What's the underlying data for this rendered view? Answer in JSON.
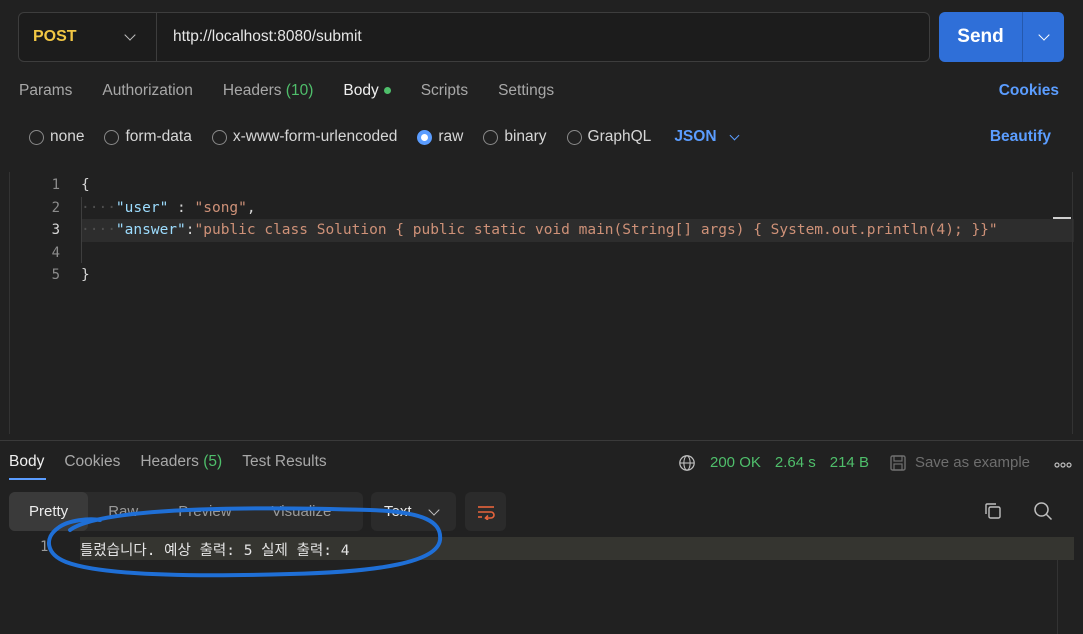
{
  "request": {
    "method": "POST",
    "url": "http://localhost:8080/submit",
    "send_label": "Send"
  },
  "request_tabs": {
    "params": "Params",
    "authorization": "Authorization",
    "headers": "Headers",
    "headers_count": "(10)",
    "body": "Body",
    "scripts": "Scripts",
    "settings": "Settings",
    "cookies": "Cookies"
  },
  "body_types": {
    "options": [
      "none",
      "form-data",
      "x-www-form-urlencoded",
      "raw",
      "binary",
      "GraphQL"
    ],
    "selected": "raw",
    "format": "JSON",
    "beautify": "Beautify"
  },
  "editor": {
    "line_numbers": [
      "1",
      "2",
      "3",
      "4",
      "5"
    ],
    "open_brace": "{",
    "close_brace": "}",
    "user_key": "\"user\"",
    "user_sep": " : ",
    "user_value": "\"song\"",
    "answer_key": "\"answer\"",
    "answer_sep": ":",
    "answer_value": "\"public class Solution { public static void main(String[] args) { System.out.println(4); }}\""
  },
  "response_tabs": {
    "body": "Body",
    "cookies": "Cookies",
    "headers": "Headers",
    "headers_count": "(5)",
    "test_results": "Test Results"
  },
  "response_meta": {
    "status": "200 OK",
    "time": "2.64 s",
    "size": "214 B",
    "save_example": "Save as example",
    "more": "ooo"
  },
  "view": {
    "modes": [
      "Pretty",
      "Raw",
      "Preview",
      "Visualize"
    ],
    "active_mode": "Pretty",
    "text_format": "Text"
  },
  "response_body": {
    "line_number": "1",
    "text": "틀렸습니다. 예상 출력: 5 실제 출력: 4"
  },
  "colors": {
    "accent": "#2f6fd8",
    "link": "#5b9dff",
    "method": "#f2c744",
    "success": "#4fbf6b",
    "annotation": "#1f6fd6"
  }
}
